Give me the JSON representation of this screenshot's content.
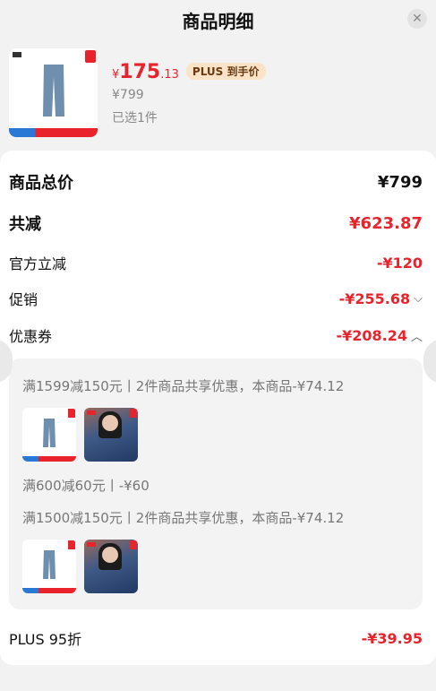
{
  "header": {
    "title": "商品明细",
    "close_icon": "close-icon"
  },
  "product": {
    "price_currency": "¥",
    "price_int": "175",
    "price_dec": ".13",
    "plus_tag": "PLUS 到手价",
    "original_price": "¥799",
    "selected_text": "已选1件"
  },
  "summary": {
    "total_label": "商品总价",
    "total_value": "¥799",
    "reduce_label": "共减",
    "reduce_value": "¥623.87",
    "official_label": "官方立减",
    "official_value": "-¥120",
    "promo_label": "促销",
    "promo_value": "-¥255.68",
    "coupon_label": "优惠券",
    "coupon_value": "-¥208.24",
    "plus_label": "PLUS 95折",
    "plus_value": "-¥39.95"
  },
  "coupons": [
    {
      "text": "满1599减150元丨2件商品共享优惠，本商品-¥74.12"
    },
    {
      "text": "满600减60元丨-¥60"
    },
    {
      "text": "满1500减150元丨2件商品共享优惠，本商品-¥74.12"
    }
  ],
  "colors": {
    "accent_red": "#e8232b",
    "plus_bg": "#fbe3c8",
    "panel_bg": "#f3f3f3"
  }
}
